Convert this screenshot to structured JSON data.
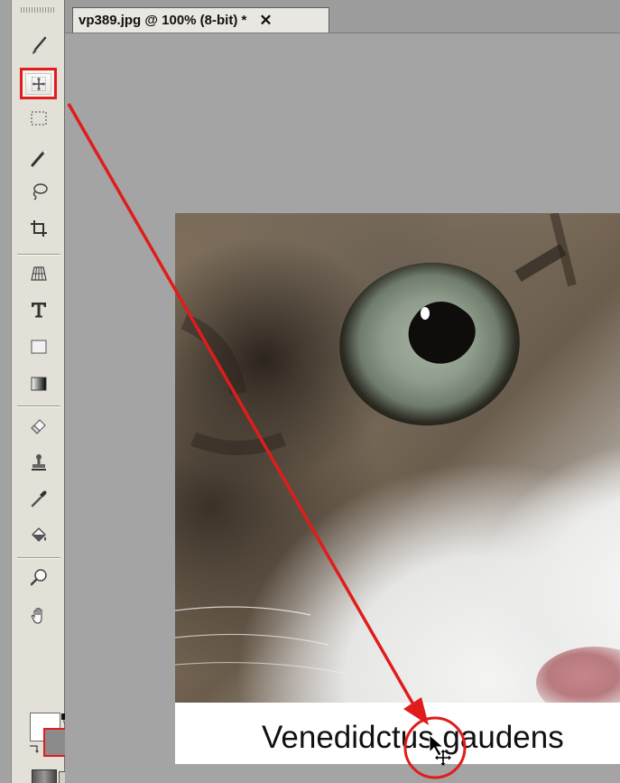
{
  "document": {
    "tab_title": "vp389.jpg @ 100% (8-bit) *",
    "tab_close": "✕"
  },
  "canvas": {
    "caption": "Venedidctus gaudens"
  },
  "toolbar": {
    "tools": [
      {
        "name": "brush-tool-icon"
      },
      {
        "name": "move-tool-icon",
        "selected": true
      },
      {
        "name": "marquee-tool-icon"
      },
      {
        "name": "magic-wand-tool-icon"
      },
      {
        "name": "lasso-tool-icon"
      },
      {
        "name": "crop-tool-icon"
      },
      {
        "name": "perspective-grid-tool-icon"
      },
      {
        "name": "type-tool-icon"
      },
      {
        "name": "shape-tool-icon"
      },
      {
        "name": "gradient-tool-icon"
      },
      {
        "name": "eraser-tool-icon"
      },
      {
        "name": "clone-stamp-tool-icon"
      },
      {
        "name": "eyedropper-tool-icon"
      },
      {
        "name": "paint-bucket-tool-icon"
      },
      {
        "name": "zoom-tool-icon"
      },
      {
        "name": "hand-tool-icon"
      }
    ],
    "foreground_color": "#ffffff",
    "background_color": "#8b8b8b"
  },
  "colors": {
    "annotation_red": "#e01c1c",
    "workspace_gray": "#a4a4a4"
  }
}
